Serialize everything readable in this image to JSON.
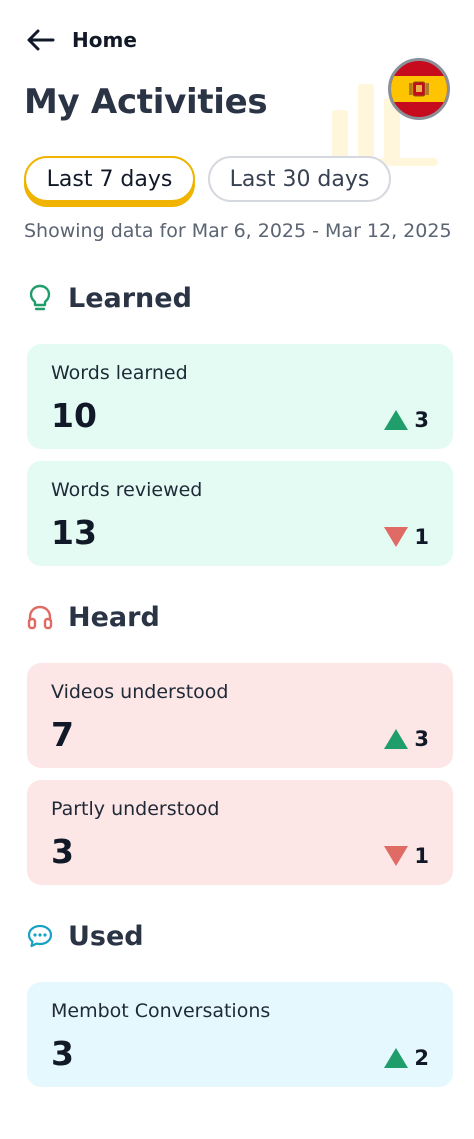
{
  "header": {
    "back_label": "Home",
    "title": "My Activities"
  },
  "language": {
    "flag": "spain-flag-icon"
  },
  "range": {
    "options": [
      "Last 7 days",
      "Last 30 days"
    ],
    "selected": "Last 7 days",
    "caption": "Showing data for Mar 6, 2025 - Mar 12, 2025"
  },
  "sections": {
    "learned": {
      "title": "Learned",
      "icon": "lightbulb-icon",
      "color": "#1f9d6b",
      "cards": [
        {
          "label": "Words learned",
          "value": "10",
          "delta": "3",
          "direction": "up"
        },
        {
          "label": "Words reviewed",
          "value": "13",
          "delta": "1",
          "direction": "down"
        }
      ]
    },
    "heard": {
      "title": "Heard",
      "icon": "headphones-icon",
      "color": "#e06a64",
      "cards": [
        {
          "label": "Videos understood",
          "value": "7",
          "delta": "3",
          "direction": "up"
        },
        {
          "label": "Partly understood",
          "value": "3",
          "delta": "1",
          "direction": "down"
        }
      ]
    },
    "used": {
      "title": "Used",
      "icon": "chat-bubble-icon",
      "color": "#17a2c4",
      "cards": [
        {
          "label": "Membot Conversations",
          "value": "3",
          "delta": "2",
          "direction": "up"
        }
      ]
    }
  },
  "colors": {
    "accent": "#f0b300",
    "up": "#1f9d6b",
    "down": "#e06a64",
    "learned_bg": "#e3fbf3",
    "heard_bg": "#fce6e6",
    "used_bg": "#e5f8fd"
  }
}
